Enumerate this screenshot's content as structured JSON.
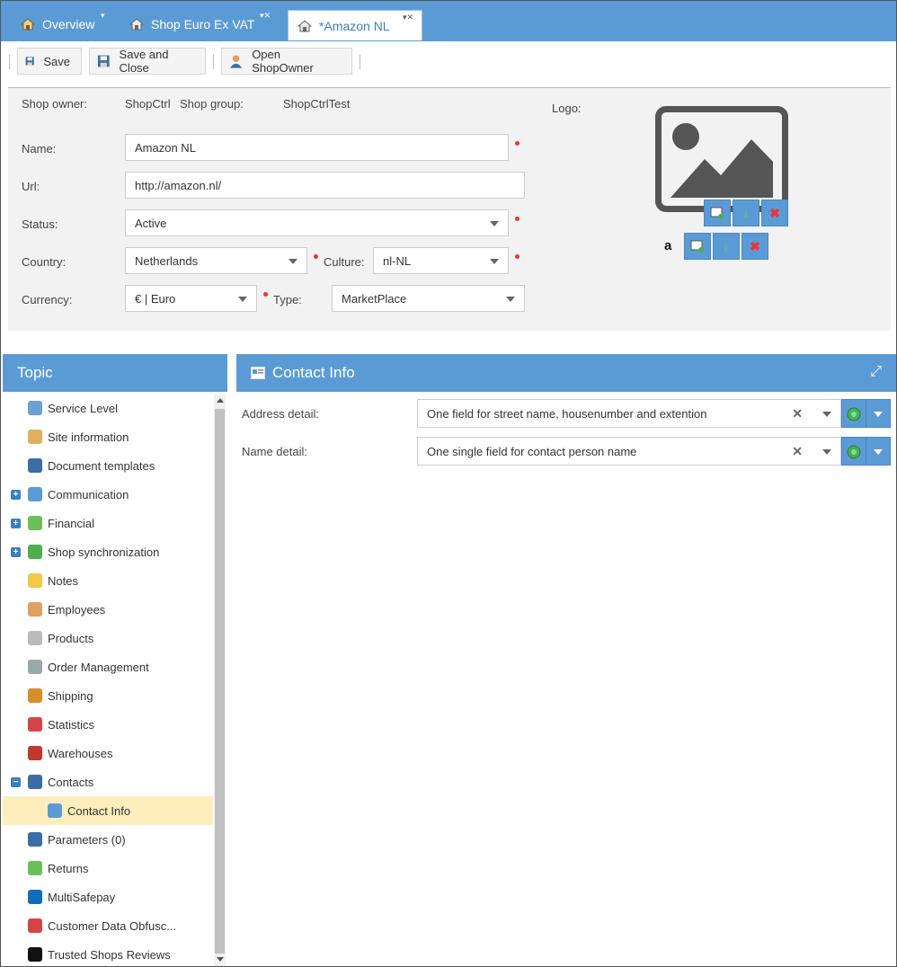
{
  "tabs": [
    {
      "label": "Overview",
      "icon": "house-icon",
      "active": false
    },
    {
      "label": "Shop Euro Ex VAT",
      "icon": "shop-icon",
      "active": false
    },
    {
      "label": "*Amazon NL",
      "icon": "shop-icon",
      "active": true
    }
  ],
  "toolbar": {
    "save": "Save",
    "save_close": "Save and Close",
    "open_owner": "Open ShopOwner"
  },
  "form": {
    "shop_owner_label": "Shop owner:",
    "shop_owner_value": "ShopCtrl",
    "shop_group_label": "Shop group:",
    "shop_group_value": "ShopCtrlTest",
    "logo_label": "Logo:",
    "name_label": "Name:",
    "name_value": "Amazon NL",
    "url_label": "Url:",
    "url_value": "http://amazon.nl/",
    "status_label": "Status:",
    "status_value": "Active",
    "country_label": "Country:",
    "country_value": "Netherlands",
    "culture_label": "Culture:",
    "culture_value": "nl-NL",
    "currency_label": "Currency:",
    "currency_value": "€ | Euro",
    "type_label": "Type:",
    "type_value": "MarketPlace",
    "amazon_glyph": "a"
  },
  "topic": {
    "title": "Topic",
    "items": [
      {
        "label": "Service Level",
        "icon": "book-icon",
        "expander": ""
      },
      {
        "label": "Site information",
        "icon": "house-icon",
        "expander": ""
      },
      {
        "label": "Document templates",
        "icon": "document-icon",
        "expander": ""
      },
      {
        "label": "Communication",
        "icon": "speech-bubble-icon",
        "expander": "+"
      },
      {
        "label": "Financial",
        "icon": "money-icon",
        "expander": "+"
      },
      {
        "label": "Shop synchronization",
        "icon": "sync-icon",
        "expander": "+"
      },
      {
        "label": "Notes",
        "icon": "note-icon",
        "expander": ""
      },
      {
        "label": "Employees",
        "icon": "people-icon",
        "expander": ""
      },
      {
        "label": "Products",
        "icon": "box-icon",
        "expander": ""
      },
      {
        "label": "Order Management",
        "icon": "basket-icon",
        "expander": ""
      },
      {
        "label": "Shipping",
        "icon": "truck-icon",
        "expander": ""
      },
      {
        "label": "Statistics",
        "icon": "bar-chart-icon",
        "expander": ""
      },
      {
        "label": "Warehouses",
        "icon": "warehouse-icon",
        "expander": ""
      },
      {
        "label": "Contacts",
        "icon": "person-icon",
        "expander": "−"
      },
      {
        "label": "Contact Info",
        "icon": "contact-card-icon",
        "expander": "",
        "child": true,
        "selected": true
      },
      {
        "label": "Parameters (0)",
        "icon": "list-icon",
        "expander": ""
      },
      {
        "label": "Returns",
        "icon": "return-basket-icon",
        "expander": ""
      },
      {
        "label": "MultiSafepay",
        "icon": "multisafepay-logo-icon",
        "expander": ""
      },
      {
        "label": "Customer Data Obfusc...",
        "icon": "person-mask-icon",
        "expander": ""
      },
      {
        "label": "Trusted Shops Reviews",
        "icon": "trusted-shops-logo-icon",
        "expander": ""
      }
    ]
  },
  "contact_info": {
    "title": "Contact Info",
    "address_label": "Address detail:",
    "address_value": "One field for street name, housenumber and extention",
    "name_label": "Name detail:",
    "name_value": "One single field for contact person name"
  },
  "colors": {
    "accent": "#5b9bd5",
    "selected": "#fdeebb",
    "required": "#e33333"
  }
}
